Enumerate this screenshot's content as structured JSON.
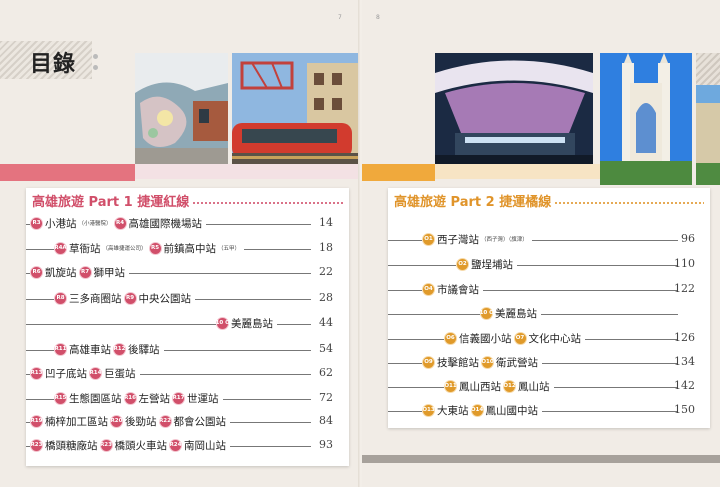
{
  "left_page": {
    "page_number": "7",
    "toc_title": "目錄",
    "band_color": "#e4737f",
    "section": {
      "title": "高雄旅遊 Part 1 捷運紅線",
      "color": "#d14f6a",
      "rows": [
        {
          "page": "14",
          "items": [
            {
              "code": "R3",
              "name": "小港站",
              "note": "（小港醫院）"
            },
            {
              "code": "R4",
              "name": "高雄國際機場站",
              "note": ""
            }
          ]
        },
        {
          "page": "18",
          "items": [
            {
              "code": "R4A",
              "name": "草衙站",
              "note": "（高雄捷運公司）"
            },
            {
              "code": "R5",
              "name": "前鎮高中站",
              "note": "（五甲）"
            }
          ]
        },
        {
          "page": "22",
          "items": [
            {
              "code": "R6",
              "name": "凱旋站",
              "note": ""
            },
            {
              "code": "R7",
              "name": "獅甲站",
              "note": ""
            }
          ]
        },
        {
          "page": "28",
          "items": [
            {
              "code": "R8",
              "name": "三多商圈站",
              "note": ""
            },
            {
              "code": "R9",
              "name": "中央公園站",
              "note": ""
            }
          ]
        },
        {
          "page": "44",
          "items": [
            {
              "code": "R10 O5",
              "name": "美麗島站",
              "note": ""
            }
          ]
        },
        {
          "page": "54",
          "items": [
            {
              "code": "R11",
              "name": "高雄車站",
              "note": ""
            },
            {
              "code": "R12",
              "name": "後驛站",
              "note": ""
            }
          ]
        },
        {
          "page": "62",
          "items": [
            {
              "code": "R13",
              "name": "凹子底站",
              "note": ""
            },
            {
              "code": "R14",
              "name": "巨蛋站",
              "note": ""
            }
          ]
        },
        {
          "page": "72",
          "items": [
            {
              "code": "R15",
              "name": "生態園區站",
              "note": ""
            },
            {
              "code": "R16",
              "name": "左營站",
              "note": ""
            },
            {
              "code": "R17",
              "name": "世運站",
              "note": ""
            }
          ]
        },
        {
          "page": "84",
          "items": [
            {
              "code": "R19",
              "name": "楠梓加工區站",
              "note": ""
            },
            {
              "code": "R20",
              "name": "後勁站",
              "note": ""
            },
            {
              "code": "R22",
              "name": "都會公園站",
              "note": ""
            }
          ]
        },
        {
          "page": "93",
          "items": [
            {
              "code": "R23",
              "name": "橋頭糖廠站",
              "note": ""
            },
            {
              "code": "R23",
              "name": "橋頭火車站",
              "note": ""
            },
            {
              "code": "R24",
              "name": "南岡山站",
              "note": ""
            }
          ]
        }
      ]
    }
  },
  "right_page": {
    "page_number": "8",
    "band_color": "#f0a93c",
    "section": {
      "title": "高雄旅遊 Part 2 捷運橘線",
      "color": "#e0942a",
      "rows": [
        {
          "page": "96",
          "items": [
            {
              "code": "O1",
              "name": "西子灣站",
              "note": "（西子灣）（旗津）"
            }
          ]
        },
        {
          "page": "110",
          "items": [
            {
              "code": "O2",
              "name": "鹽埕埔站",
              "note": ""
            }
          ]
        },
        {
          "page": "122",
          "items": [
            {
              "code": "O4",
              "name": "市議會站",
              "note": ""
            }
          ]
        },
        {
          "page": "",
          "items": [
            {
              "code": "R10 O5",
              "name": "美麗島站",
              "note": ""
            }
          ]
        },
        {
          "page": "126",
          "items": [
            {
              "code": "O6",
              "name": "信義國小站",
              "note": ""
            },
            {
              "code": "O7",
              "name": "文化中心站",
              "note": ""
            }
          ]
        },
        {
          "page": "134",
          "items": [
            {
              "code": "O9",
              "name": "技擊館站",
              "note": ""
            },
            {
              "code": "O10",
              "name": "衛武營站",
              "note": ""
            }
          ]
        },
        {
          "page": "142",
          "items": [
            {
              "code": "O11",
              "name": "鳳山西站",
              "note": ""
            },
            {
              "code": "O12",
              "name": "鳳山站",
              "note": ""
            }
          ]
        },
        {
          "page": "150",
          "items": [
            {
              "code": "O13",
              "name": "大東站",
              "note": ""
            },
            {
              "code": "O14",
              "name": "鳳山國中站",
              "note": ""
            }
          ]
        }
      ]
    }
  }
}
